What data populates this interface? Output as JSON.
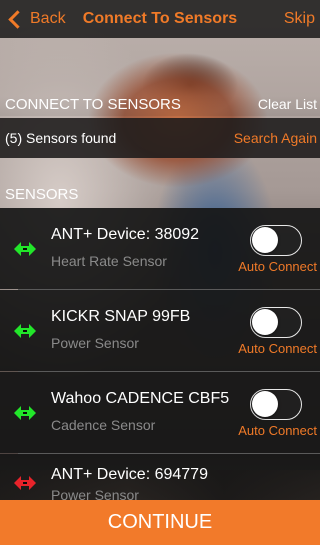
{
  "nav": {
    "back_label": "Back",
    "title": "Connect To Sensors",
    "skip_label": "Skip"
  },
  "connect_section": {
    "header": "CONNECT TO SENSORS",
    "clear_label": "Clear List"
  },
  "found_bar": {
    "text": "(5) Sensors found",
    "search_label": "Search Again"
  },
  "sensors_section": {
    "header": "SENSORS"
  },
  "sensors": [
    {
      "name": "ANT+ Device: 38092",
      "type": "Heart Rate Sensor",
      "status": "connected",
      "auto_connect": false,
      "auto_label": "Auto Connect"
    },
    {
      "name": "KICKR SNAP 99FB",
      "type": "Power Sensor",
      "status": "connected",
      "auto_connect": false,
      "auto_label": "Auto Connect"
    },
    {
      "name": "Wahoo CADENCE CBF5",
      "type": "Cadence Sensor",
      "status": "connected",
      "auto_connect": false,
      "auto_label": "Auto Connect"
    },
    {
      "name": "ANT+ Device: 694779",
      "type": "Power Sensor",
      "status": "disconnected"
    }
  ],
  "continue_label": "CONTINUE",
  "colors": {
    "accent": "#f07a28",
    "connected": "#22e62a",
    "disconnected": "#e8232a"
  }
}
